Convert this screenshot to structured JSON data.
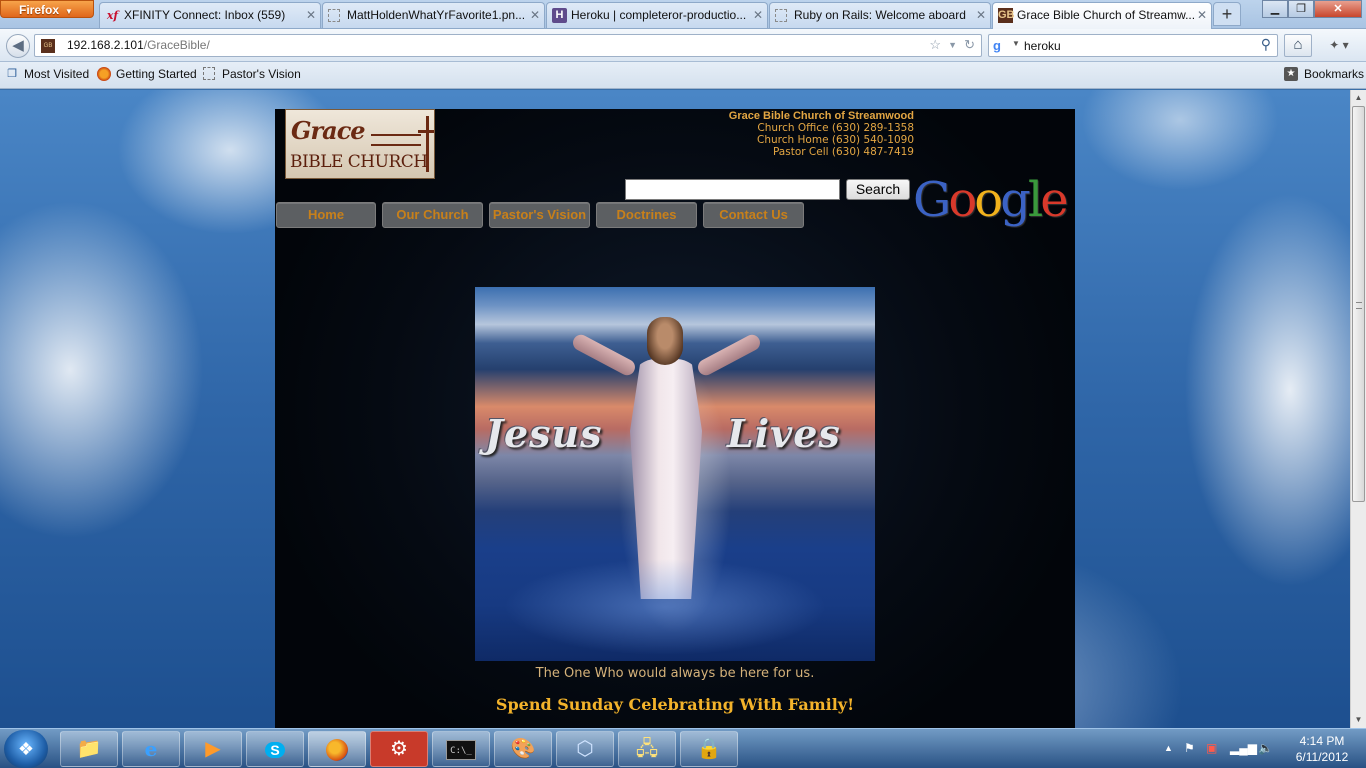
{
  "browser": {
    "menu_label": "Firefox",
    "tabs": [
      {
        "title": "XFINITY Connect: Inbox (559)",
        "icon": "xfinity-icon"
      },
      {
        "title": "MattHoldenWhatYrFavorite1.pn...",
        "icon": "image-file-icon"
      },
      {
        "title": "Heroku | completeror-productio...",
        "icon": "heroku-icon"
      },
      {
        "title": "Ruby on Rails: Welcome aboard",
        "icon": "blank-page-icon"
      },
      {
        "title": "Grace Bible Church of Streamw...",
        "icon": "grace-favicon",
        "active": true
      }
    ],
    "url_host": "192.168.2.101",
    "url_path": "/GraceBible/",
    "search_value": "heroku",
    "bookmarks": [
      {
        "label": "Most Visited",
        "icon": "most-visited-icon"
      },
      {
        "label": "Getting Started",
        "icon": "firefox-icon"
      },
      {
        "label": "Pastor's Vision",
        "icon": "blank-page-icon"
      }
    ],
    "bookmarks_menu": "Bookmarks"
  },
  "page": {
    "logo_word1": "Grace",
    "logo_word2": "BIBLE CHURCH",
    "contact": {
      "name": "Grace Bible Church of Streamwood",
      "office": "Church Office (630) 289-1358",
      "home": "Church Home (630) 540-1090",
      "cell": "Pastor Cell (630) 487-7419"
    },
    "search_button": "Search",
    "google_letters": [
      "G",
      "o",
      "o",
      "g",
      "l",
      "e"
    ],
    "nav": [
      "Home",
      "Our Church",
      "Pastor's Vision",
      "Doctrines",
      "Contact Us"
    ],
    "hero_words": [
      "Jesus",
      "Lives"
    ],
    "caption": "The One Who would always be here for us.",
    "tagline": "Spend Sunday Celebrating With Family!"
  },
  "taskbar": {
    "apps": [
      "windows-explorer-icon",
      "internet-explorer-icon",
      "media-player-icon",
      "skype-icon",
      "firefox-icon",
      "settings-gear-icon",
      "command-prompt-icon",
      "paint-icon",
      "virtualbox-icon",
      "remote-desktop-icon",
      "vpn-lock-icon"
    ],
    "time": "4:14 PM",
    "date": "6/11/2012"
  },
  "colors": {
    "accent_orange": "#e3a643",
    "nav_text": "#c8801a",
    "tagline": "#f3b32b",
    "page_bg": "#050a12"
  }
}
